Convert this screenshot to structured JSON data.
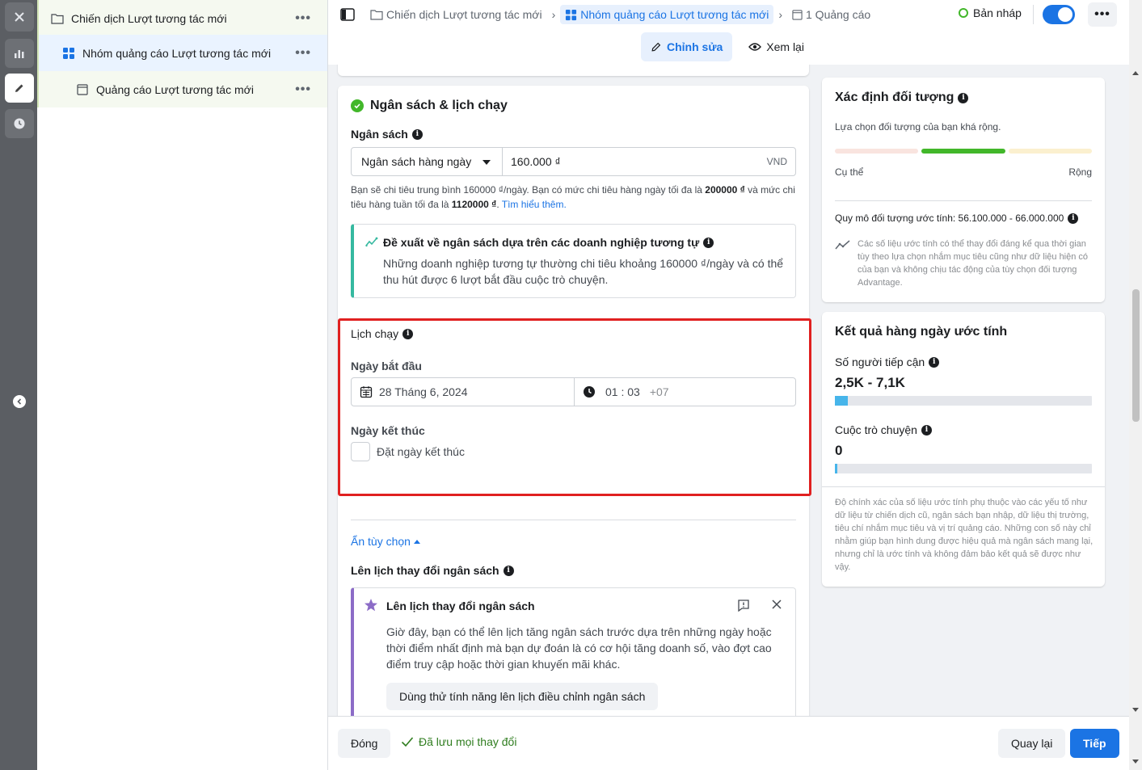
{
  "tree": {
    "campaign": {
      "label": "Chiến dịch Lượt tương tác mới",
      "icon": "folder-icon"
    },
    "adset": {
      "label": "Nhóm quảng cáo Lượt tương tác mới",
      "icon": "grid-icon"
    },
    "ad": {
      "label": "Quảng cáo Lượt tương tác mới",
      "icon": "document-icon"
    },
    "more_label": "•••"
  },
  "breadcrumb": {
    "campaign": "Chiến dịch Lượt tương tác mới",
    "adset": "Nhóm quảng cáo Lượt tương tác mới",
    "ad": "1 Quảng cáo"
  },
  "status": {
    "label": "Bản nháp",
    "toggle_on": true
  },
  "more_label": "•••",
  "mode_tabs": {
    "edit": "Chỉnh sửa",
    "review": "Xem lại"
  },
  "budget": {
    "section_title": "Ngân sách & lịch chạy",
    "label": "Ngân sách",
    "type": "Ngân sách hàng ngày",
    "amount": "160.000 ₫",
    "currency": "VND",
    "help_1": "Bạn sẽ chi tiêu trung bình 160000 ₫/ngày. Bạn có mức chi tiêu hàng ngày tối đa là ",
    "help_max_daily": "200000 ₫",
    "help_2": " và mức chi tiêu hàng tuần tối đa là ",
    "help_max_weekly": "1120000 ₫",
    "help_3": ". ",
    "learn_more": "Tìm hiểu thêm.",
    "suggest_title": "Đề xuất về ngân sách dựa trên các doanh nghiệp tương tự",
    "suggest_body": "Những doanh nghiệp tương tự thường chi tiêu khoảng 160000 ₫/ngày và có thể thu hút được 6 lượt bắt đầu cuộc trò chuyện."
  },
  "schedule": {
    "title": "Lịch chạy",
    "start_label": "Ngày bắt đầu",
    "start_date": "28 Tháng 6, 2024",
    "start_time": "01 : 03",
    "timezone": "+07",
    "end_label": "Ngày kết thúc",
    "end_checkbox": "Đặt ngày kết thúc"
  },
  "hide_options": "Ẩn tùy chọn",
  "budget_schedule": {
    "label": "Lên lịch thay đổi ngân sách",
    "promo_title": "Lên lịch thay đổi ngân sách",
    "promo_body": "Giờ đây, bạn có thể lên lịch tăng ngân sách trước dựa trên những ngày hoặc thời điểm nhất định mà bạn dự đoán là có cơ hội tăng doanh số, vào đợt cao điểm truy cập hoặc thời gian khuyến mãi khác.",
    "try_button": "Dùng thử tính năng lên lịch điều chỉnh ngân sách"
  },
  "audience": {
    "title": "Xác định đối tượng",
    "subtitle": "Lựa chọn đối tượng của bạn khá rộng.",
    "specific": "Cụ thể",
    "broad": "Rộng",
    "size": "Quy mô đối tượng ước tính: 56.100.000 - 66.000.000",
    "note": "Các số liệu ước tính có thể thay đổi đáng kể qua thời gian tùy theo lựa chọn nhắm mục tiêu cũng như dữ liệu hiện có của bạn và không chịu tác động của tùy chọn đối tượng Advantage."
  },
  "results": {
    "title": "Kết quả hàng ngày ước tính",
    "reach_label": "Số người tiếp cận",
    "reach_value": "2,5K - 7,1K",
    "reach_fill": 0.05,
    "conv_label": "Cuộc trò chuyện",
    "conv_value": "0",
    "conv_fill": 0.008,
    "note": "Độ chính xác của số liệu ước tính phụ thuộc vào các yếu tố như dữ liệu từ chiến dịch cũ, ngân sách bạn nhập, dữ liệu thị trường, tiêu chí nhắm mục tiêu và vị trí quảng cáo. Những con số này chỉ nhằm giúp bạn hình dung được hiệu quả mà ngân sách mang lại, nhưng chỉ là ước tính và không đảm bảo kết quả sẽ được như vậy."
  },
  "footer": {
    "close": "Đóng",
    "saved": "Đã lưu mọi thay đổi",
    "back": "Quay lại",
    "next": "Tiếp"
  },
  "colors": {
    "accent": "#1b74e4",
    "success": "#42b72a",
    "highlight": "#e02020"
  }
}
